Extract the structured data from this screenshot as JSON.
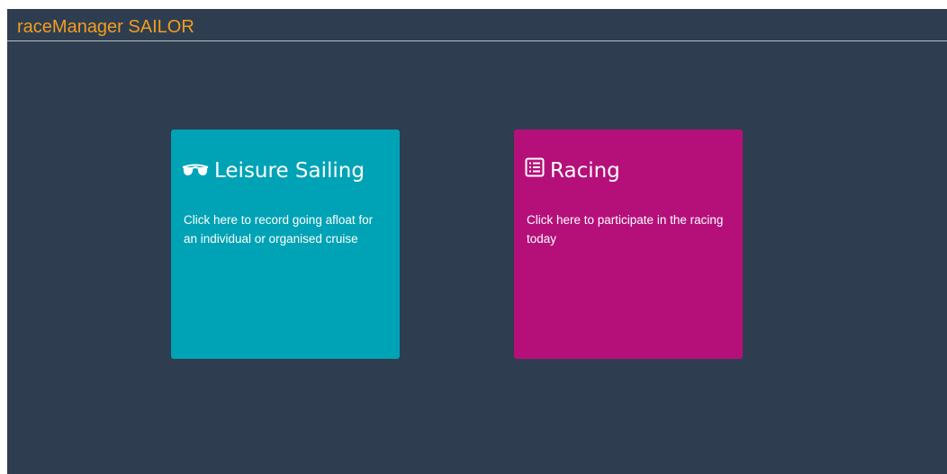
{
  "app": {
    "brand": "raceManager SAILOR"
  },
  "colors": {
    "background": "#2e3e50",
    "brand": "#f39c1f",
    "leisure_tile": "#00a3b6",
    "racing_tile": "#b5107a"
  },
  "tiles": [
    {
      "icon": "sunglasses-icon",
      "title": "Leisure Sailing",
      "description": "Click here to record going afloat for an individual or organised cruise"
    },
    {
      "icon": "list-alt-icon",
      "title": "Racing",
      "description": "Click here to participate in the racing today"
    }
  ]
}
